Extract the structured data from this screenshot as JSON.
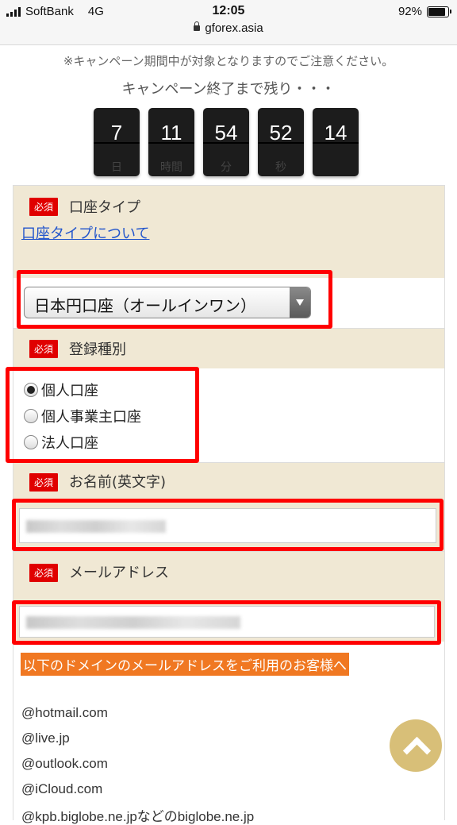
{
  "status_bar": {
    "carrier": "SoftBank",
    "network": "4G",
    "time": "12:05",
    "battery": "92%",
    "url": "gforex.asia"
  },
  "campaign": {
    "notice": "※キャンペーン期間中が対象となりますのでご注意ください。",
    "remaining": "キャンペーン終了まで残り・・・",
    "countdown": [
      {
        "value": "7",
        "unit": "日"
      },
      {
        "value": "11",
        "unit": "時間"
      },
      {
        "value": "54",
        "unit": "分"
      },
      {
        "value": "52",
        "unit": "秒"
      },
      {
        "value": "14",
        "unit": ""
      }
    ]
  },
  "form": {
    "required_badge": "必須",
    "account_type": {
      "label": "口座タイプ",
      "link": "口座タイプについて",
      "selected": "日本円口座（オールインワン）"
    },
    "registration": {
      "label": "登録種別",
      "options": [
        "個人口座",
        "個人事業主口座",
        "法人口座"
      ],
      "selected_index": 0
    },
    "name": {
      "label": "お名前(英文字)"
    },
    "email": {
      "label": "メールアドレス"
    },
    "domain_notice": "以下のドメインのメールアドレスをご利用のお客様へ",
    "domains": [
      "@hotmail.com",
      "@live.jp",
      "@outlook.com",
      "@iCloud.com",
      "@kpb.biglobe.ne.jpなどのbiglobe.ne.jp"
    ]
  },
  "colors": {
    "accent_red": "#ff0000",
    "label_bg": "#f0e8d4",
    "banner_orange": "#f07822",
    "link_blue": "#2255cc",
    "scroll_top_gold": "#d4b96a"
  },
  "icons": [
    "signal-icon",
    "lock-icon",
    "battery-icon",
    "dropdown-arrow-icon",
    "chevron-up-icon"
  ]
}
